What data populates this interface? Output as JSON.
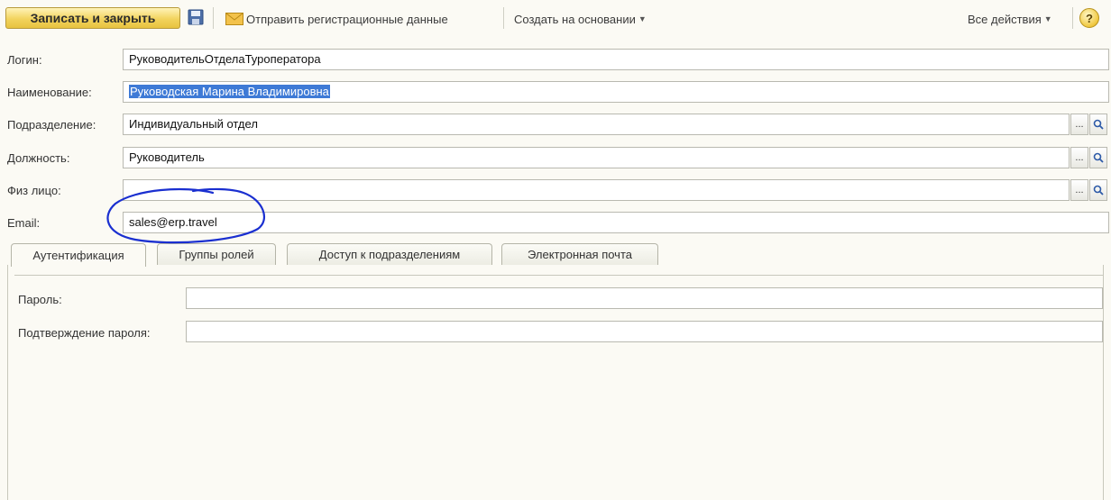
{
  "toolbar": {
    "save_close_label": "Записать и закрыть",
    "send_reg_label": "Отправить регистрационные данные",
    "create_based_label": "Создать на основании",
    "all_actions_label": "Все действия",
    "help_label": "?"
  },
  "form": {
    "login": {
      "label": "Логин:",
      "value": "РуководительОтделаТуроператора"
    },
    "name": {
      "label": "Наименование:",
      "value": "Руководская Марина Владимировна"
    },
    "department": {
      "label": "Подразделение:",
      "value": "Индивидуальный отдел"
    },
    "position": {
      "label": "Должность:",
      "value": "Руководитель"
    },
    "person": {
      "label": "Физ лицо:",
      "value": ""
    },
    "email": {
      "label": "Email:",
      "value": "sales@erp.travel"
    }
  },
  "select_button_label": "...",
  "tabs": [
    {
      "label": "Аутентификация",
      "active": true
    },
    {
      "label": "Группы ролей",
      "active": false
    },
    {
      "label": "Доступ к подразделениям",
      "active": false
    },
    {
      "label": "Электронная почта",
      "active": false
    }
  ],
  "auth": {
    "password_label": "Пароль:",
    "password_value": "",
    "confirm_label": "Подтверждение пароля:",
    "confirm_value": ""
  },
  "colors": {
    "accent_button": "#f2d35d",
    "selection": "#3e7ad6",
    "annotation_ink": "#1a2fd0"
  }
}
